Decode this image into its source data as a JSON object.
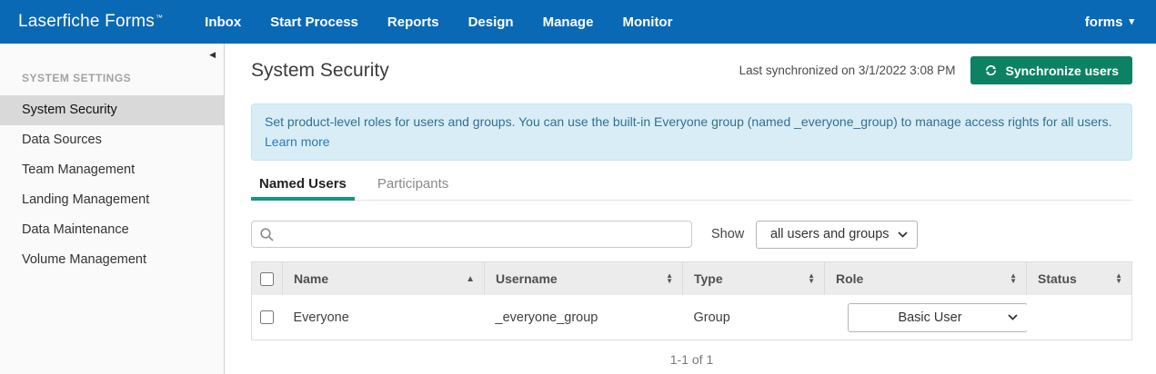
{
  "navbar": {
    "brand": "Laserfiche Forms",
    "trademark": "TM",
    "items": [
      "Inbox",
      "Start Process",
      "Reports",
      "Design",
      "Manage",
      "Monitor"
    ],
    "user_menu": "forms"
  },
  "sidebar": {
    "section_title": "SYSTEM SETTINGS",
    "items": [
      {
        "label": "System Security",
        "active": true
      },
      {
        "label": "Data Sources",
        "active": false
      },
      {
        "label": "Team Management",
        "active": false
      },
      {
        "label": "Landing Management",
        "active": false
      },
      {
        "label": "Data Maintenance",
        "active": false
      },
      {
        "label": "Volume Management",
        "active": false
      }
    ]
  },
  "header": {
    "title": "System Security",
    "last_synchronized": "Last synchronized on 3/1/2022 3:08 PM",
    "synchronize_button": "Synchronize users"
  },
  "banner": {
    "text": "Set product-level roles for users and groups. You can use the built-in Everyone group (named _everyone_group) to manage access rights for all users.",
    "link_label": "Learn more"
  },
  "tabs": [
    {
      "label": "Named Users",
      "active": true
    },
    {
      "label": "Participants",
      "active": false
    }
  ],
  "filters": {
    "search_value": "",
    "search_placeholder": "",
    "show_label": "Show",
    "show_selected": "all users and groups"
  },
  "table": {
    "columns": [
      {
        "label": "Name",
        "sort": "ascending"
      },
      {
        "label": "Username",
        "sort": "none"
      },
      {
        "label": "Type",
        "sort": "none"
      },
      {
        "label": "Role",
        "sort": "none"
      },
      {
        "label": "Status",
        "sort": "none"
      }
    ],
    "rows": [
      {
        "name": "Everyone",
        "username": "_everyone_group",
        "type": "Group",
        "role": "Basic User",
        "status": ""
      }
    ],
    "pagination": "1-1 of 1"
  },
  "colors": {
    "navbar_blue": "#0a69b4",
    "accent_green": "#0d8164",
    "tab_underline_teal": "#12967d",
    "banner_background": "#d9edf7",
    "banner_border": "#bce8f1",
    "banner_text": "#31708f",
    "link_blue": "#2a7ab9",
    "selected_sidebar_item": "#d9d9d9"
  }
}
